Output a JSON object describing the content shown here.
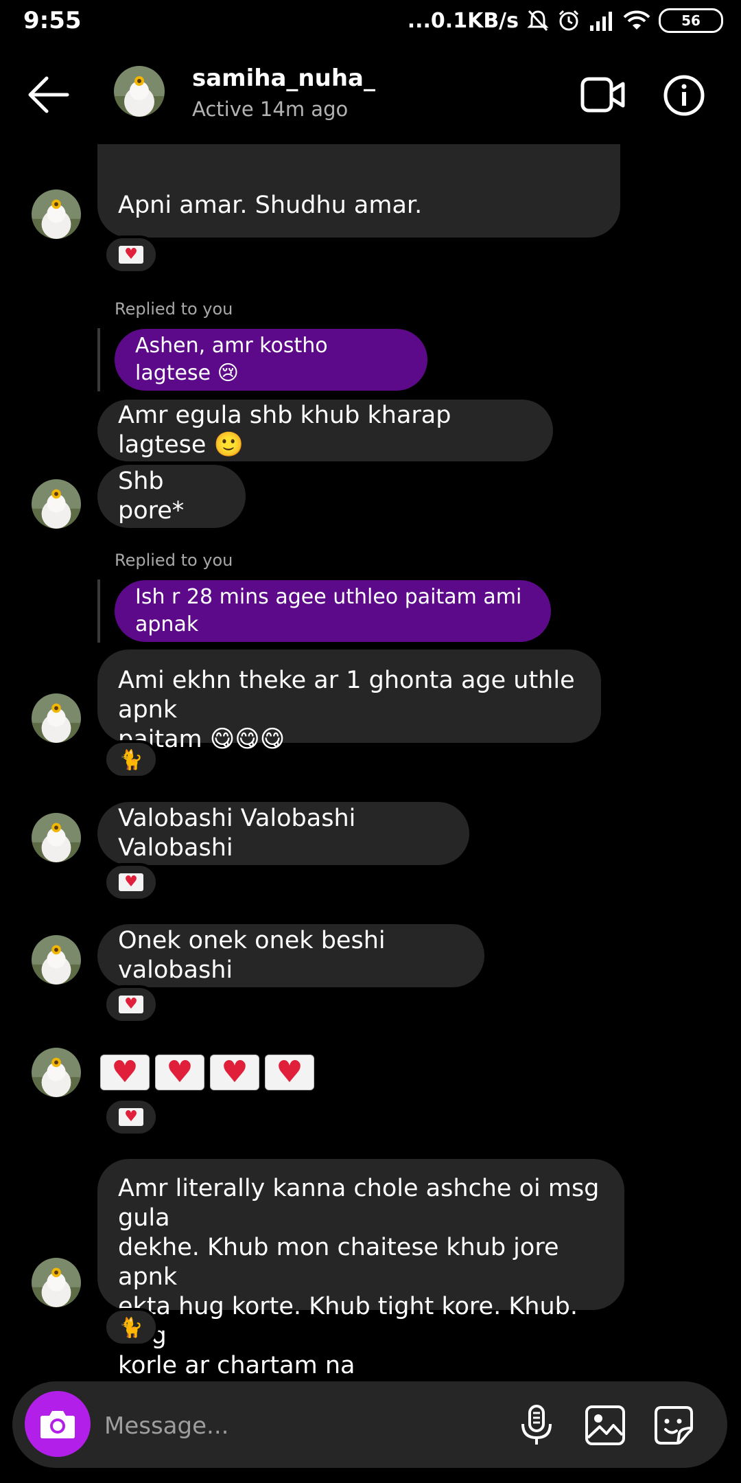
{
  "status_bar": {
    "time": "9:55",
    "network_speed": "...0.1KB/s",
    "battery": "56",
    "icons": [
      "mute-bell-icon",
      "alarm-icon",
      "signal-icon",
      "wifi-icon",
      "battery-icon"
    ]
  },
  "header": {
    "username": "samiha_nuha_",
    "active_status": "Active 14m ago",
    "icons": [
      "back-arrow-icon",
      "video-call-icon",
      "info-icon"
    ]
  },
  "messages": {
    "m1_text": "Apni amar. Shudhu amar.",
    "m1_reaction": "love-letter",
    "reply1_label": "Replied to you",
    "reply1_text": "Ashen, amr kostho lagtese 😢",
    "m2_text": "Amr egula shb khub kharap lagtese 🙂",
    "m3_text": "Shb pore*",
    "reply2_label": "Replied to you",
    "reply2_text": "Ish r 28 mins agee uthleo paitam ami apnak",
    "m4_line1": "Ami ekhn theke ar 1 ghonta age uthle apnk",
    "m4_line2": "paitam 😋😋😋",
    "m4_reaction": "🐈",
    "m5_text": "Valobashi Valobashi Valobashi",
    "m6_text": "Onek onek onek beshi valobashi",
    "m7_letters": 4,
    "m8_line1": "Amr literally kanna chole ashche oi msg gula",
    "m8_line2": "dekhe. Khub mon chaitese khub jore apnk",
    "m8_line3": "ekta hug korte. Khub tight kore. Khub. Hug",
    "m8_line4": "korle ar chartam na",
    "m8_reaction": "🐈"
  },
  "composer": {
    "placeholder": "Message...",
    "icons": [
      "camera-icon",
      "microphone-icon",
      "gallery-icon",
      "sticker-icon"
    ]
  },
  "colors": {
    "background": "#000000",
    "incoming_bubble": "#262626",
    "reply_bubble": "#5d0a8a",
    "camera_button": "#b11fe8",
    "secondary_text": "#b3b3b3"
  }
}
